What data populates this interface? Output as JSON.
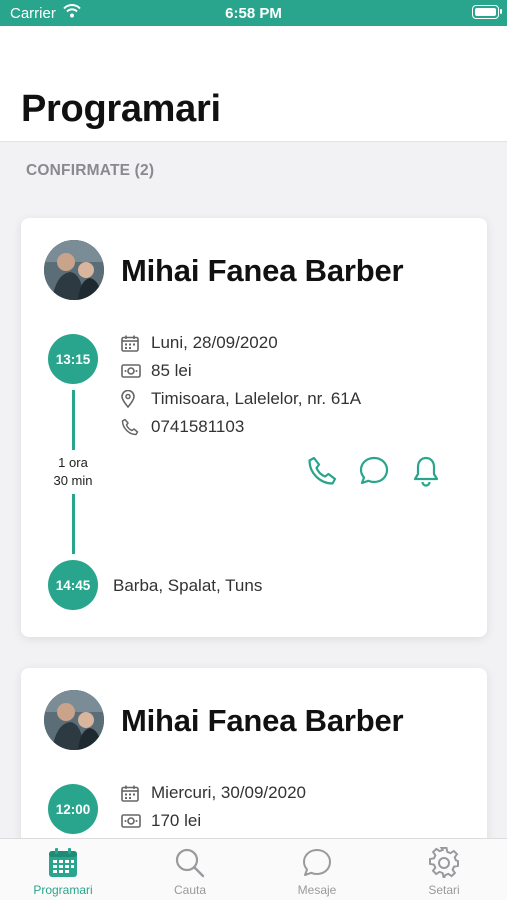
{
  "status_bar": {
    "carrier": "Carrier",
    "time": "6:58 PM"
  },
  "header": {
    "title": "Programari"
  },
  "section": {
    "title": "CONFIRMATE (2)"
  },
  "appointments": [
    {
      "name": "Mihai Fanea Barber",
      "start": "13:15",
      "end": "14:45",
      "duration_line1": "1 ora",
      "duration_line2": "30 min",
      "date": "Luni, 28/09/2020",
      "price": "85 lei",
      "address": "Timisoara, Lalelelor, nr. 61A",
      "phone": "0741581103",
      "services": "Barba, Spalat, Tuns"
    },
    {
      "name": "Mihai Fanea Barber",
      "start": "12:00",
      "date": "Miercuri, 30/09/2020",
      "price": "170 lei"
    }
  ],
  "tabs": [
    {
      "label": "Programari",
      "icon": "calendar-icon",
      "active": true
    },
    {
      "label": "Cauta",
      "icon": "search-icon",
      "active": false
    },
    {
      "label": "Mesaje",
      "icon": "chat-icon",
      "active": false
    },
    {
      "label": "Setari",
      "icon": "gear-icon",
      "active": false
    }
  ],
  "colors": {
    "accent": "#2aa58d",
    "status_bar": "#2aa58d",
    "inactive": "#9a9a9e"
  }
}
